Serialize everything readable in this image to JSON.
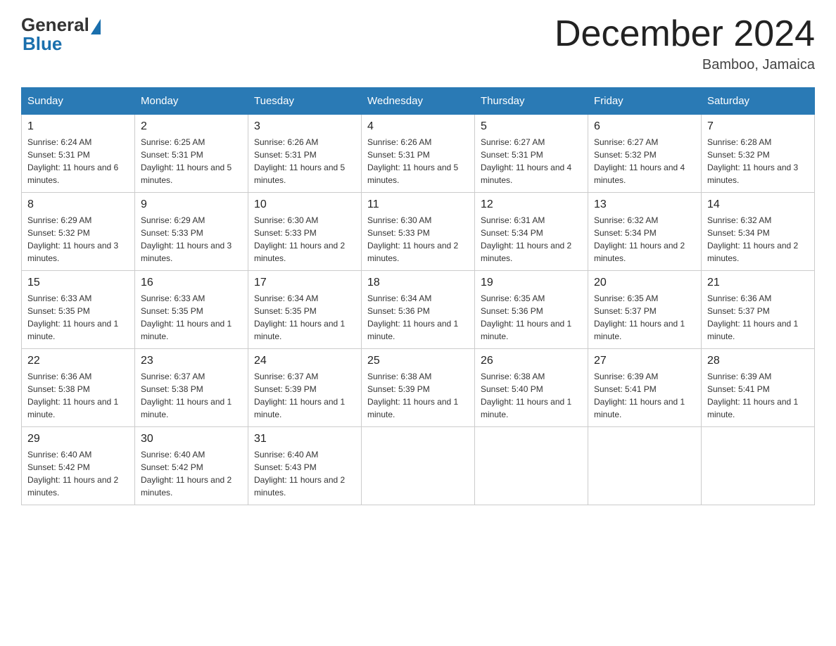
{
  "header": {
    "title": "December 2024",
    "location": "Bamboo, Jamaica",
    "logo_general": "General",
    "logo_blue": "Blue"
  },
  "days_of_week": [
    "Sunday",
    "Monday",
    "Tuesday",
    "Wednesday",
    "Thursday",
    "Friday",
    "Saturday"
  ],
  "weeks": [
    [
      {
        "day": "1",
        "sunrise": "6:24 AM",
        "sunset": "5:31 PM",
        "daylight": "11 hours and 6 minutes."
      },
      {
        "day": "2",
        "sunrise": "6:25 AM",
        "sunset": "5:31 PM",
        "daylight": "11 hours and 5 minutes."
      },
      {
        "day": "3",
        "sunrise": "6:26 AM",
        "sunset": "5:31 PM",
        "daylight": "11 hours and 5 minutes."
      },
      {
        "day": "4",
        "sunrise": "6:26 AM",
        "sunset": "5:31 PM",
        "daylight": "11 hours and 5 minutes."
      },
      {
        "day": "5",
        "sunrise": "6:27 AM",
        "sunset": "5:31 PM",
        "daylight": "11 hours and 4 minutes."
      },
      {
        "day": "6",
        "sunrise": "6:27 AM",
        "sunset": "5:32 PM",
        "daylight": "11 hours and 4 minutes."
      },
      {
        "day": "7",
        "sunrise": "6:28 AM",
        "sunset": "5:32 PM",
        "daylight": "11 hours and 3 minutes."
      }
    ],
    [
      {
        "day": "8",
        "sunrise": "6:29 AM",
        "sunset": "5:32 PM",
        "daylight": "11 hours and 3 minutes."
      },
      {
        "day": "9",
        "sunrise": "6:29 AM",
        "sunset": "5:33 PM",
        "daylight": "11 hours and 3 minutes."
      },
      {
        "day": "10",
        "sunrise": "6:30 AM",
        "sunset": "5:33 PM",
        "daylight": "11 hours and 2 minutes."
      },
      {
        "day": "11",
        "sunrise": "6:30 AM",
        "sunset": "5:33 PM",
        "daylight": "11 hours and 2 minutes."
      },
      {
        "day": "12",
        "sunrise": "6:31 AM",
        "sunset": "5:34 PM",
        "daylight": "11 hours and 2 minutes."
      },
      {
        "day": "13",
        "sunrise": "6:32 AM",
        "sunset": "5:34 PM",
        "daylight": "11 hours and 2 minutes."
      },
      {
        "day": "14",
        "sunrise": "6:32 AM",
        "sunset": "5:34 PM",
        "daylight": "11 hours and 2 minutes."
      }
    ],
    [
      {
        "day": "15",
        "sunrise": "6:33 AM",
        "sunset": "5:35 PM",
        "daylight": "11 hours and 1 minute."
      },
      {
        "day": "16",
        "sunrise": "6:33 AM",
        "sunset": "5:35 PM",
        "daylight": "11 hours and 1 minute."
      },
      {
        "day": "17",
        "sunrise": "6:34 AM",
        "sunset": "5:35 PM",
        "daylight": "11 hours and 1 minute."
      },
      {
        "day": "18",
        "sunrise": "6:34 AM",
        "sunset": "5:36 PM",
        "daylight": "11 hours and 1 minute."
      },
      {
        "day": "19",
        "sunrise": "6:35 AM",
        "sunset": "5:36 PM",
        "daylight": "11 hours and 1 minute."
      },
      {
        "day": "20",
        "sunrise": "6:35 AM",
        "sunset": "5:37 PM",
        "daylight": "11 hours and 1 minute."
      },
      {
        "day": "21",
        "sunrise": "6:36 AM",
        "sunset": "5:37 PM",
        "daylight": "11 hours and 1 minute."
      }
    ],
    [
      {
        "day": "22",
        "sunrise": "6:36 AM",
        "sunset": "5:38 PM",
        "daylight": "11 hours and 1 minute."
      },
      {
        "day": "23",
        "sunrise": "6:37 AM",
        "sunset": "5:38 PM",
        "daylight": "11 hours and 1 minute."
      },
      {
        "day": "24",
        "sunrise": "6:37 AM",
        "sunset": "5:39 PM",
        "daylight": "11 hours and 1 minute."
      },
      {
        "day": "25",
        "sunrise": "6:38 AM",
        "sunset": "5:39 PM",
        "daylight": "11 hours and 1 minute."
      },
      {
        "day": "26",
        "sunrise": "6:38 AM",
        "sunset": "5:40 PM",
        "daylight": "11 hours and 1 minute."
      },
      {
        "day": "27",
        "sunrise": "6:39 AM",
        "sunset": "5:41 PM",
        "daylight": "11 hours and 1 minute."
      },
      {
        "day": "28",
        "sunrise": "6:39 AM",
        "sunset": "5:41 PM",
        "daylight": "11 hours and 1 minute."
      }
    ],
    [
      {
        "day": "29",
        "sunrise": "6:40 AM",
        "sunset": "5:42 PM",
        "daylight": "11 hours and 2 minutes."
      },
      {
        "day": "30",
        "sunrise": "6:40 AM",
        "sunset": "5:42 PM",
        "daylight": "11 hours and 2 minutes."
      },
      {
        "day": "31",
        "sunrise": "6:40 AM",
        "sunset": "5:43 PM",
        "daylight": "11 hours and 2 minutes."
      },
      {
        "day": "",
        "sunrise": "",
        "sunset": "",
        "daylight": ""
      },
      {
        "day": "",
        "sunrise": "",
        "sunset": "",
        "daylight": ""
      },
      {
        "day": "",
        "sunrise": "",
        "sunset": "",
        "daylight": ""
      },
      {
        "day": "",
        "sunrise": "",
        "sunset": "",
        "daylight": ""
      }
    ]
  ],
  "labels": {
    "sunrise": "Sunrise:",
    "sunset": "Sunset:",
    "daylight": "Daylight:"
  }
}
